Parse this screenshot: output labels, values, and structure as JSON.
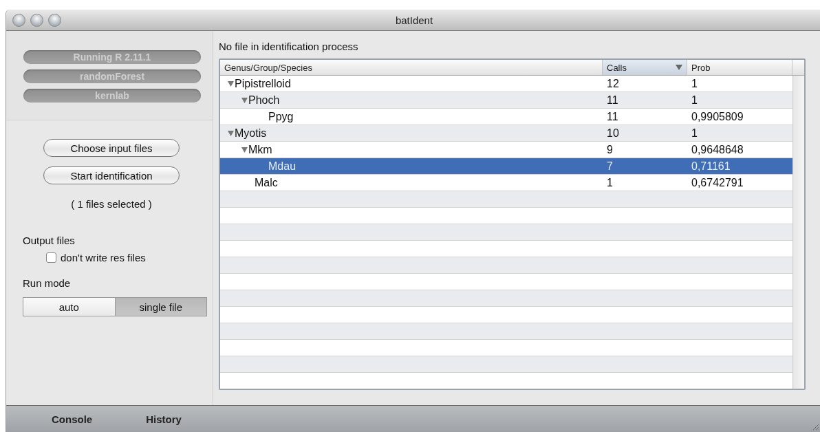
{
  "window": {
    "title": "batIdent"
  },
  "status_pills": [
    "Running R 2.11.1",
    "randomForest",
    "kernlab"
  ],
  "buttons": [
    "Choose input files",
    "Start identification"
  ],
  "files_selected": "( 1 files selected )",
  "output": {
    "heading": "Output files",
    "checkbox": {
      "label": "don't write res files",
      "checked": false
    }
  },
  "run_mode": {
    "heading": "Run mode",
    "options": [
      {
        "label": "auto",
        "selected": false
      },
      {
        "label": "single file",
        "selected": true
      }
    ]
  },
  "process_status": "No file in identification process",
  "table": {
    "columns": [
      {
        "label": "Genus/Group/Species",
        "sorted": false
      },
      {
        "label": "Calls",
        "sorted": true
      },
      {
        "label": "Prob",
        "sorted": false
      }
    ],
    "rows": [
      {
        "name": "Pipistrelloid",
        "calls": "12",
        "prob": "1",
        "selected": false,
        "expanded": true,
        "children": [
          {
            "name": "Phoch",
            "calls": "11",
            "prob": "1",
            "selected": false,
            "expanded": true,
            "children": [
              {
                "name": "Ppyg",
                "calls": "11",
                "prob": "0,9905809",
                "selected": false
              }
            ]
          }
        ]
      },
      {
        "name": "Myotis",
        "calls": "10",
        "prob": "1",
        "selected": false,
        "expanded": true,
        "children": [
          {
            "name": "Mkm",
            "calls": "9",
            "prob": "0,9648648",
            "selected": false,
            "expanded": true,
            "children": [
              {
                "name": "Mdau",
                "calls": "7",
                "prob": "0,71161",
                "selected": true
              }
            ]
          },
          {
            "name": "Malc",
            "calls": "1",
            "prob": "0,6742791",
            "selected": false
          }
        ]
      }
    ]
  },
  "bottom_tabs": [
    "Console",
    "History"
  ]
}
